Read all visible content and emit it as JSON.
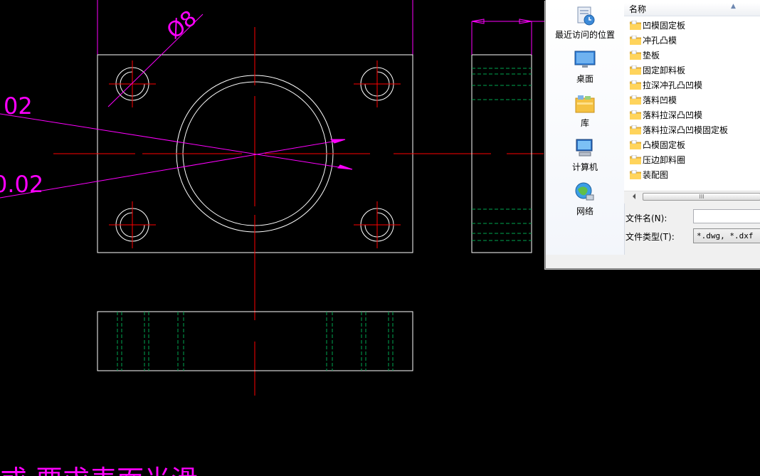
{
  "cad": {
    "dim_diameter": "Ø8",
    "dim_tol_top": "02",
    "dim_tol_bottom": "0.02",
    "bottom_note": "或  要求表面光滑"
  },
  "dialog": {
    "places": [
      {
        "label": "最近访问的位置",
        "icon": "recent-places-icon"
      },
      {
        "label": "桌面",
        "icon": "desktop-icon"
      },
      {
        "label": "库",
        "icon": "libraries-icon"
      },
      {
        "label": "计算机",
        "icon": "computer-icon"
      },
      {
        "label": "网络",
        "icon": "network-icon"
      }
    ],
    "column_header": "名称",
    "files": [
      "凹模固定板",
      "冲孔凸模",
      "垫板",
      "固定卸料板",
      "拉深冲孔凸凹模",
      "落料凹模",
      "落料拉深凸凹模",
      "落料拉深凸凹模固定板",
      "凸模固定板",
      "压边卸料圈",
      "装配图"
    ],
    "filename_label": "文件名(N):",
    "filename_value": "",
    "filetype_label": "文件类型(T):",
    "filetype_value": "*.dwg, *.dxf",
    "scroll_grip": "III"
  },
  "colors": {
    "background": "#000000",
    "outline": "#ffffff",
    "centerline": "#ff0000",
    "dimension": "#ff00ff",
    "hidden": "#00a651",
    "folder": "#f5c242"
  }
}
